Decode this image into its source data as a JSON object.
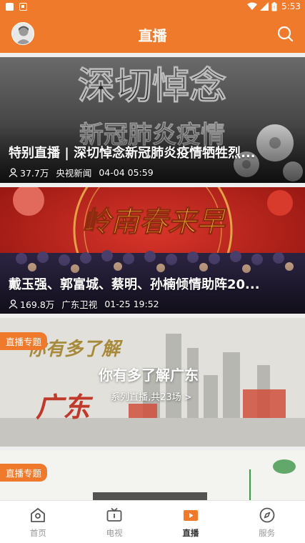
{
  "status_bar": {
    "time": "5:53"
  },
  "header": {
    "title": "直播",
    "avatar_icon": "user-avatar-icon",
    "search_icon": "search-icon"
  },
  "colors": {
    "accent": "#f07a2c",
    "nav_active": "#f07a2c",
    "nav_inactive": "#555555"
  },
  "cards": [
    {
      "image_text": [
        "深切悼念",
        "新冠肺炎疫情"
      ],
      "title": "特别直播 | 深切悼念新冠肺炎疫情牺牲烈...",
      "views": "37.7万",
      "source": "央视新闻",
      "time": "04-04 05:59"
    },
    {
      "image_text": "岭南春来早",
      "title": "戴玉强、郭富城、蔡明、孙楠倾情助阵20...",
      "views": "169.8万",
      "source": "广东卫视",
      "time": "01-25 19:52"
    },
    {
      "badge": "直播专题",
      "image_text": "你有多了解广东",
      "title": "你有多了解广东",
      "subtitle": "系列直播,共23场 >"
    },
    {
      "badge": "直播专题"
    }
  ],
  "bottom_nav": [
    {
      "label": "首页",
      "icon": "home-icon",
      "active": false
    },
    {
      "label": "电视",
      "icon": "tv-icon",
      "active": false
    },
    {
      "label": "直播",
      "icon": "live-video-icon",
      "active": true
    },
    {
      "label": "服务",
      "icon": "compass-icon",
      "active": false
    }
  ]
}
